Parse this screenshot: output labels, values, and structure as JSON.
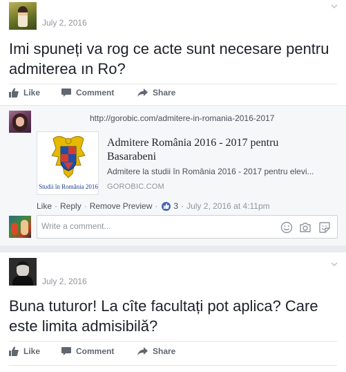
{
  "post1": {
    "date": "July 2, 2016",
    "text": "Imi spuneți va rog ce acte sunt necesare pentru admiterea ın Ro?",
    "actions": {
      "like": "Like",
      "comment": "Comment",
      "share": "Share"
    }
  },
  "comment": {
    "link_url": "http://gorobic.com/admitere-in-romania-2016-2017",
    "preview": {
      "title": "Admitere România 2016 - 2017 pentru Basarabeni",
      "description": "Admitere la studii în România 2016 - 2017 pentru elevi...",
      "domain": "GOROBIC.COM",
      "thumb_caption": "Studii în România 2016"
    },
    "meta": {
      "like": "Like",
      "reply": "Reply",
      "remove_preview": "Remove Preview",
      "reaction_count": "3",
      "timestamp": "July 2, 2016 at 4:11pm",
      "separator": "·"
    }
  },
  "write_comment": {
    "placeholder": "Write a comment..."
  },
  "post2": {
    "date": "July 2, 2016",
    "text": "Buna tuturor! La cîte facultați pot aplica? Care este limita admisibilă?",
    "actions": {
      "like": "Like",
      "comment": "Comment",
      "share": "Share"
    }
  },
  "colors": {
    "fb_blue": "#4267b2",
    "meta_gray": "#90949c",
    "action_gray": "#606770",
    "comment_bg": "#f6f7f9"
  }
}
